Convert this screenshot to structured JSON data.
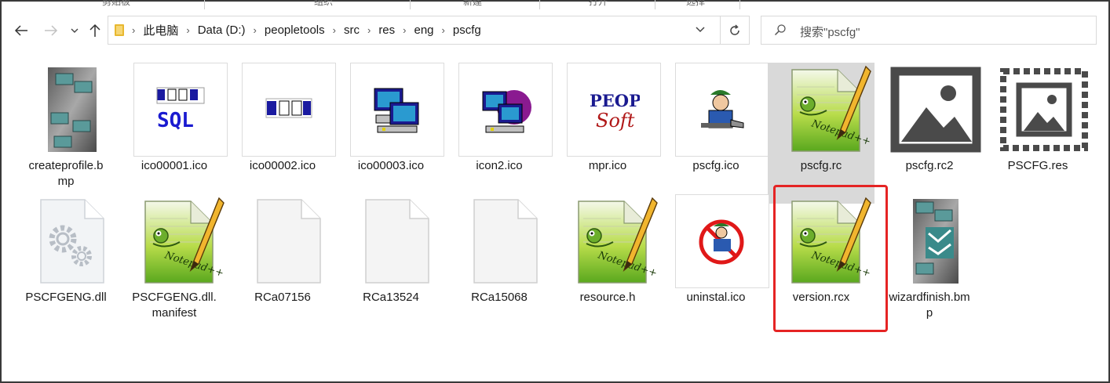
{
  "ribbon": {
    "groups": [
      "剪贴板",
      "组织",
      "新建",
      "打开",
      "选择"
    ]
  },
  "nav": {
    "back_icon": "arrow-left-icon",
    "forward_icon": "arrow-right-icon",
    "recent_icon": "chevron-down-icon",
    "up_icon": "arrow-up-icon"
  },
  "address": {
    "crumbs": [
      "此电脑",
      "Data (D:)",
      "peopletools",
      "src",
      "res",
      "eng",
      "pscfg"
    ],
    "dropdown_icon": "chevron-down-icon",
    "refresh_icon": "refresh-icon"
  },
  "search": {
    "placeholder": "搜索\"pscfg\""
  },
  "files": [
    {
      "name": "createprofile.bmp",
      "label": "createprofile.b\nmp",
      "type": "bmp-wizard"
    },
    {
      "name": "ico00001.ico",
      "label": "ico00001.ico",
      "type": "ico-sql"
    },
    {
      "name": "ico00002.ico",
      "label": "ico00002.ico",
      "type": "ico-odbc"
    },
    {
      "name": "ico00003.ico",
      "label": "ico00003.ico",
      "type": "ico-network"
    },
    {
      "name": "icon2.ico",
      "label": "icon2.ico",
      "type": "ico-network2"
    },
    {
      "name": "mpr.ico",
      "label": "mpr.ico",
      "type": "ico-peoplesoft"
    },
    {
      "name": "pscfg.ico",
      "label": "pscfg.ico",
      "type": "ico-worker"
    },
    {
      "name": "pscfg.rc",
      "label": "pscfg.rc",
      "type": "notepadpp",
      "selected": true
    },
    {
      "name": "pscfg.rc2",
      "label": "pscfg.rc2",
      "type": "image-generic"
    },
    {
      "name": "PSCFG.res",
      "label": "PSCFG.res",
      "type": "image-dotted"
    },
    {
      "name": "PSCFGENG.dll",
      "label": "PSCFGENG.dll",
      "type": "dll"
    },
    {
      "name": "PSCFGENG.dll.manifest",
      "label": "PSCFGENG.dll.\nmanifest",
      "type": "notepadpp"
    },
    {
      "name": "RCa07156",
      "label": "RCa07156",
      "type": "blank"
    },
    {
      "name": "RCa13524",
      "label": "RCa13524",
      "type": "blank"
    },
    {
      "name": "RCa15068",
      "label": "RCa15068",
      "type": "blank"
    },
    {
      "name": "resource.h",
      "label": "resource.h",
      "type": "notepadpp"
    },
    {
      "name": "uninstal.ico",
      "label": "uninstal.ico",
      "type": "ico-uninstall"
    },
    {
      "name": "version.rcx",
      "label": "version.rcx",
      "type": "notepadpp",
      "highlighted": true
    },
    {
      "name": "wizardfinish.bmp",
      "label": "wizardfinish.bm\np",
      "type": "bmp-wizard2"
    }
  ],
  "colors": {
    "selection": "#d9d9d9",
    "highlight": "#e52424",
    "folder": "#e8b830"
  }
}
